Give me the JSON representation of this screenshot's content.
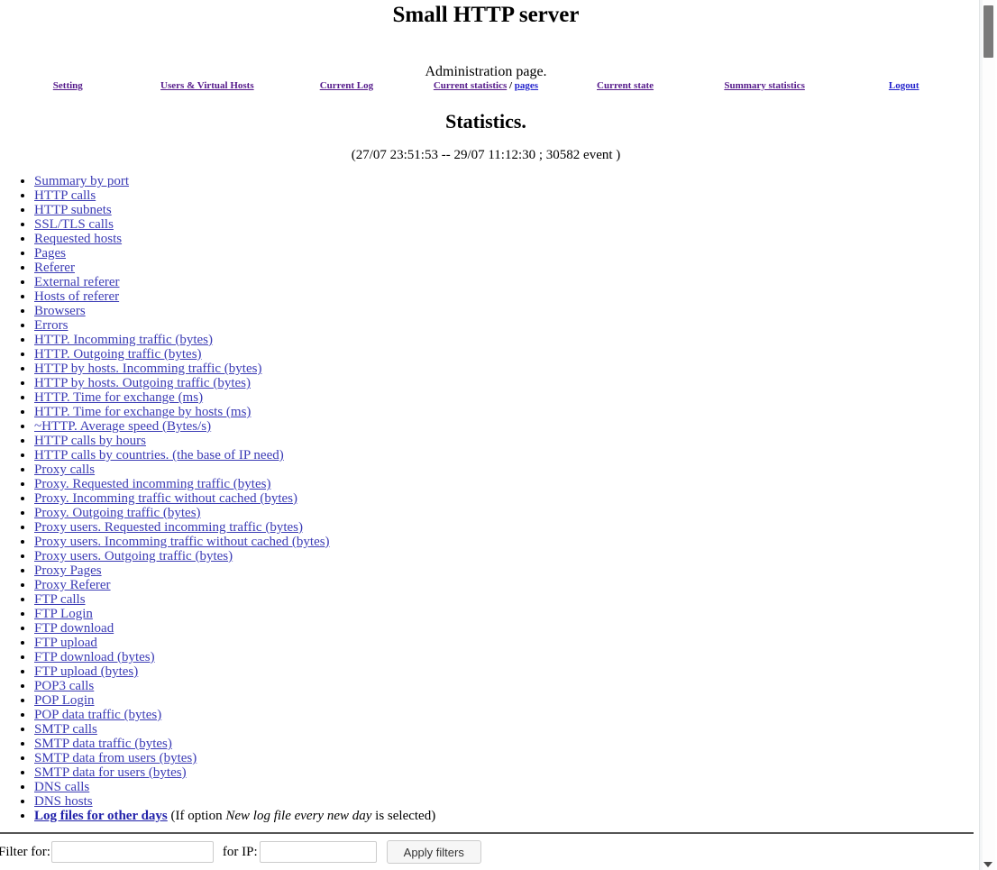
{
  "header": {
    "app_title": "Small HTTP server",
    "subtitle": "Administration page."
  },
  "nav": {
    "items": [
      {
        "label": "Setting"
      },
      {
        "label": "Users & Virtual Hosts"
      },
      {
        "label": "Current Log"
      },
      {
        "label": "Current statistics",
        "separator": " / ",
        "label2": "pages"
      },
      {
        "label": "Current state"
      },
      {
        "label": "Summary statistics"
      },
      {
        "label": "Logout"
      }
    ]
  },
  "main": {
    "page_title": "Statistics.",
    "range": "(27/07 23:51:53 -- 29/07 11:12:30 ; 30582 event )",
    "links": [
      {
        "label": "Summary by port"
      },
      {
        "label": "HTTP calls"
      },
      {
        "label": "HTTP subnets"
      },
      {
        "label": "SSL/TLS calls"
      },
      {
        "label": "Requested hosts"
      },
      {
        "label": "Pages"
      },
      {
        "label": "Referer"
      },
      {
        "label": "External referer"
      },
      {
        "label": "Hosts of referer"
      },
      {
        "label": "Browsers"
      },
      {
        "label": "Errors"
      },
      {
        "label": "HTTP. Incomming traffic (bytes)"
      },
      {
        "label": "HTTP. Outgoing traffic (bytes)"
      },
      {
        "label": "HTTP by hosts. Incomming traffic (bytes)"
      },
      {
        "label": "HTTP by hosts. Outgoing traffic (bytes)"
      },
      {
        "label": "HTTP. Time for exchange (ms)"
      },
      {
        "label": "HTTP. Time for exchange by hosts (ms)"
      },
      {
        "label": "~HTTP. Average speed (Bytes/s)"
      },
      {
        "label": "HTTP calls by hours"
      },
      {
        "label": "HTTP calls by countries. (the base of IP need)"
      },
      {
        "label": "Proxy calls"
      },
      {
        "label": "Proxy. Requested incomming traffic (bytes)"
      },
      {
        "label": "Proxy. Incomming traffic without cached (bytes)"
      },
      {
        "label": "Proxy. Outgoing traffic (bytes)"
      },
      {
        "label": "Proxy users. Requested incomming traffic (bytes)"
      },
      {
        "label": "Proxy users. Incomming traffic without cached (bytes)"
      },
      {
        "label": "Proxy users. Outgoing traffic (bytes)"
      },
      {
        "label": "Proxy Pages"
      },
      {
        "label": "Proxy Referer"
      },
      {
        "label": "FTP calls"
      },
      {
        "label": "FTP Login"
      },
      {
        "label": "FTP download"
      },
      {
        "label": "FTP upload"
      },
      {
        "label": "FTP download (bytes)"
      },
      {
        "label": "FTP upload (bytes)"
      },
      {
        "label": "POP3 calls"
      },
      {
        "label": "POP Login"
      },
      {
        "label": "POP data traffic (bytes)"
      },
      {
        "label": "SMTP calls"
      },
      {
        "label": "SMTP data traffic (bytes)"
      },
      {
        "label": "SMTP data from users (bytes)"
      },
      {
        "label": "SMTP data for users (bytes)"
      },
      {
        "label": "DNS calls"
      },
      {
        "label": "DNS hosts"
      }
    ],
    "last_link": {
      "label": "Log files for other days",
      "note_before": " (If option ",
      "note_italic": "New log file every new day",
      "note_after": " is selected)"
    }
  },
  "filters": {
    "for_label": "Filter for:",
    "for_value": "",
    "for_placeholder": "",
    "ip_label": "for IP:",
    "ip_value": "",
    "ip_placeholder": "",
    "apply_label": "Apply filters"
  },
  "colors": {
    "link": "#3b3bb5",
    "nav_link": "#551a8b",
    "nav_link_alt": "#2222cc",
    "background": "#ffffff",
    "text": "#000000",
    "divider": "#555555",
    "scrollbar_thumb": "#7a7a7a"
  }
}
